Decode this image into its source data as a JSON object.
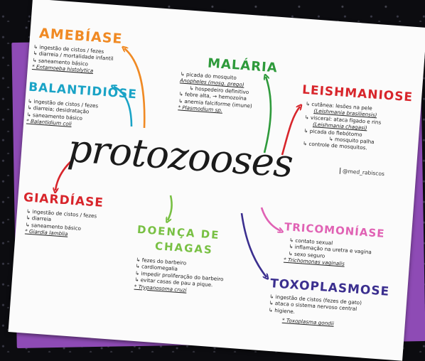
{
  "center_title": "protozooses",
  "handle": "@med_rabiscos",
  "colors": {
    "amebiase": "#f08a24",
    "balantidiose": "#1aa3c6",
    "malaria": "#2e9a3b",
    "leishmaniose": "#d8252b",
    "giardiase": "#d8252b",
    "chagas": "#78c043",
    "tricomoniase": "#e062b4",
    "toxoplasmose": "#3b2f8f"
  },
  "amebiase": {
    "title": "AMEBÍASE",
    "items": [
      "↳ ingestão de cistos / fezes",
      "↳ diarreia / mortalidade infantil",
      "↳ saneamento básico",
      "* Entamoeba histolytica"
    ]
  },
  "balantidiose": {
    "title": "BALANTIDIOSE",
    "items": [
      "↳ ingestão de cistos / fezes",
      "↳ diarreia; desidratação",
      "↳ saneamento básico",
      "* Balantidium coli"
    ]
  },
  "malaria": {
    "title": "MALÁRIA",
    "items": [
      "↳ picada do mosquito",
      "Anopheles (mosq. prego)",
      "↳ hospedeiro definitivo",
      "↳ febre alta, → hemozoína",
      "↳ anemia falciforme (imune)",
      "* Plasmodium sp."
    ]
  },
  "leishmaniose": {
    "title": "LEISHMANIOSE",
    "items": [
      "↳ cutânea: lesões na pele",
      "(Leishmania brasiliensis)",
      "↳ visceral: ataca fígado e rins",
      "(Leishmania chagasi)",
      "↳ picada do flebótomo",
      "↳ mosquito palha",
      "↳ controle de mosquitos."
    ]
  },
  "giardiase": {
    "title": "GIARDÍASE",
    "items": [
      "↳ ingestão de cistos / fezes",
      "↳ diarreia",
      "↳ saneamento básico",
      "* Giardia lamblia"
    ]
  },
  "chagas": {
    "title_line1": "DOENÇA DE",
    "title_line2": "CHAGAS",
    "items": [
      "↳ fezes do barbeiro",
      "↳ cardiomegalia",
      "↳ impedir proliferação do barbeiro",
      "↳ evitar casas de pau a pique.",
      "* Trypanosoma cruzi"
    ]
  },
  "tricomoniase": {
    "title": "TRICOMONÍASE",
    "items": [
      "↳ contato sexual",
      "↳ inflamação na uretra e vagina",
      "↳ sexo seguro",
      "* Trichomonas vaginalis"
    ]
  },
  "toxoplasmose": {
    "title": "TOXOPLASMOSE",
    "items": [
      "↳ ingestão de cistos (fezes de gato)",
      "↳ ataca o sistema nervoso central",
      "↳ higiene.",
      "* Toxoplasma gondii"
    ]
  }
}
